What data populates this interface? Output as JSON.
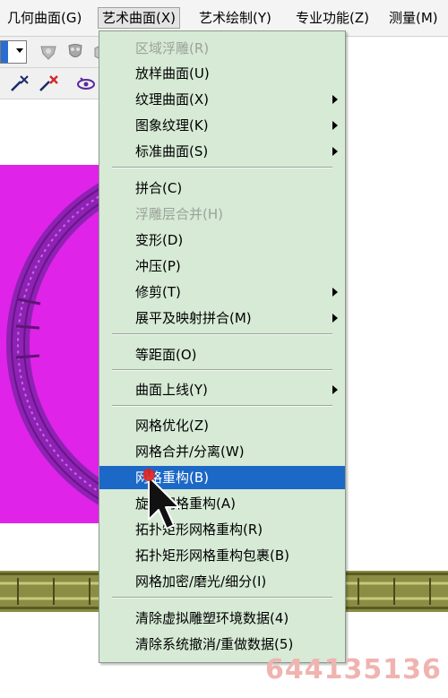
{
  "menubar": {
    "items": [
      {
        "label": "几何曲面(G)"
      },
      {
        "label": "艺术曲面(X)"
      },
      {
        "label": "艺术绘制(Y)"
      },
      {
        "label": "专业功能(Z)"
      },
      {
        "label": "测量(M)"
      }
    ]
  },
  "toolbar": {
    "icons": [
      "relief-icon",
      "shield-icon",
      "pin-add-icon",
      "pin-remove-icon",
      "eye-icon"
    ]
  },
  "dropdown": {
    "items": [
      {
        "label": "区域浮雕(R)",
        "disabled": true
      },
      {
        "label": "放样曲面(U)"
      },
      {
        "label": "纹理曲面(X)",
        "submenu": true
      },
      {
        "label": "图象纹理(K)",
        "submenu": true
      },
      {
        "label": "标准曲面(S)",
        "submenu": true
      },
      {
        "label": "拼合(C)"
      },
      {
        "label": "浮雕层合并(H)",
        "disabled": true
      },
      {
        "label": "变形(D)"
      },
      {
        "label": "冲压(P)"
      },
      {
        "label": "修剪(T)",
        "submenu": true
      },
      {
        "label": "展平及映射拼合(M)",
        "submenu": true
      },
      {
        "label": "等距面(O)"
      },
      {
        "label": "曲面上线(Y)",
        "submenu": true
      },
      {
        "label": "网格优化(Z)"
      },
      {
        "label": "网格合并/分离(W)"
      },
      {
        "label": "网格重构(B)",
        "highlighted": true
      },
      {
        "label": "旋转网格重构(A)"
      },
      {
        "label": "拓扑矩形网格重构(R)"
      },
      {
        "label": "拓扑矩形网格重构包裹(B)"
      },
      {
        "label": "网格加密/磨光/细分(I)"
      },
      {
        "label": "清除虚拟雕塑环境数据(4)"
      },
      {
        "label": "清除系统撤消/重做数据(5)"
      }
    ]
  },
  "watermark": "644135136",
  "colors": {
    "highlight": "#1c68c7",
    "menu_bg": "#d6ead6",
    "surface": "#e023e8",
    "ring": "#9a28b8",
    "border_strip": "#8a8d44"
  }
}
